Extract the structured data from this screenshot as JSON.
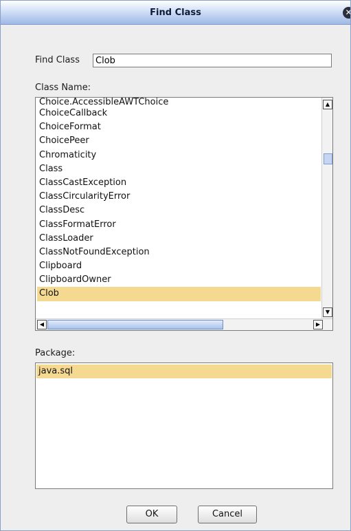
{
  "window": {
    "title": "Find Class",
    "close_glyph": "✕"
  },
  "find": {
    "label": "Find Class",
    "value": "Clob"
  },
  "class_list": {
    "label": "Class Name:",
    "items": [
      "Choice.AccessibleAWTChoice",
      "ChoiceCallback",
      "ChoiceFormat",
      "ChoicePeer",
      "Chromaticity",
      "Class",
      "ClassCastException",
      "ClassCircularityError",
      "ClassDesc",
      "ClassFormatError",
      "ClassLoader",
      "ClassNotFoundException",
      "Clipboard",
      "ClipboardOwner",
      "Clob"
    ],
    "selected": "Clob"
  },
  "package_list": {
    "label": "Package:",
    "items": [
      "java.sql"
    ],
    "selected": "java.sql"
  },
  "buttons": {
    "ok": "OK",
    "cancel": "Cancel"
  },
  "colors": {
    "selection": "#f6d991",
    "titlebar": "#9fb9e6"
  },
  "icons": {
    "close": "close-icon",
    "scroll_up": "scroll-up-arrow-icon",
    "scroll_down": "scroll-down-arrow-icon",
    "scroll_left": "scroll-left-arrow-icon",
    "scroll_right": "scroll-right-arrow-icon"
  }
}
